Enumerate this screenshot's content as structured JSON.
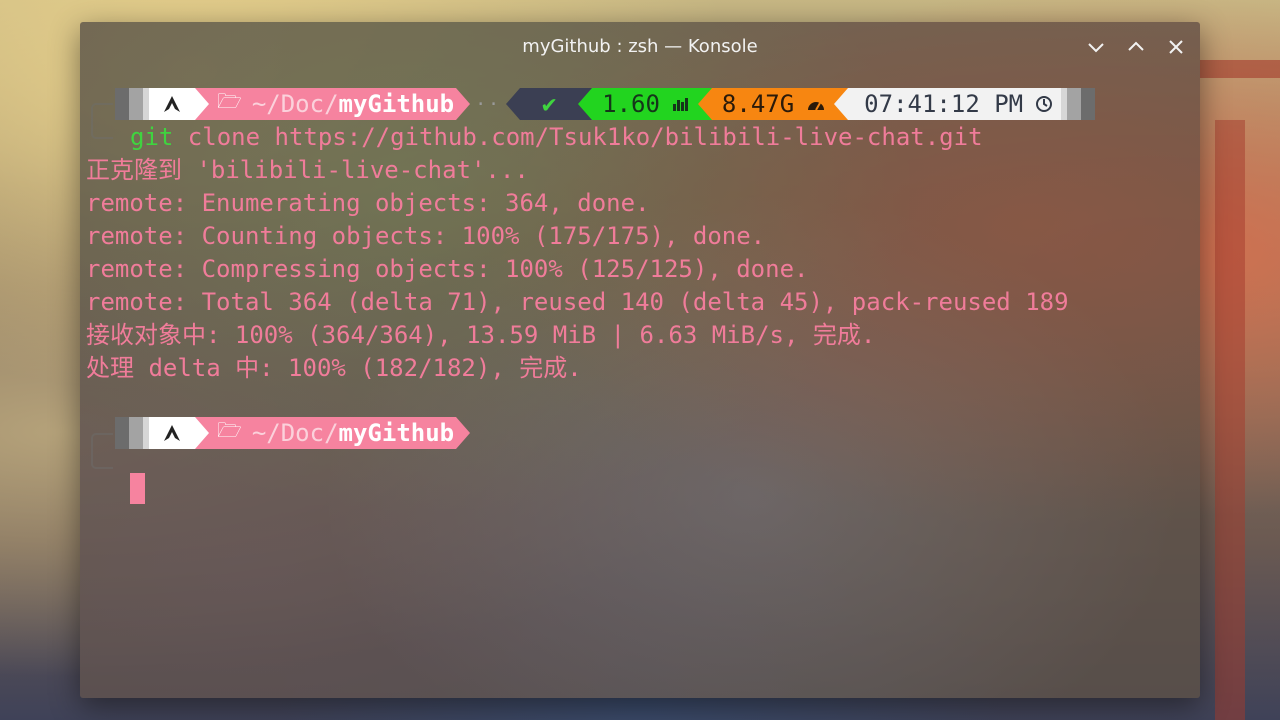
{
  "window": {
    "title": "myGithub : zsh — Konsole"
  },
  "titlebar_buttons": {
    "minimize_icon": "chevron-down-icon",
    "maximize_icon": "chevron-up-icon",
    "close_icon": "close-icon"
  },
  "prompt1": {
    "os_icon": "arch-linux-icon",
    "folder_icon": "folder-icon",
    "path_prefix": "~/",
    "path_middle": "Doc",
    "path_sep": "/",
    "path_current": "myGithub",
    "filler": "··",
    "status": "✔",
    "load": "1.60",
    "load_icon": "bar-chart-icon",
    "memory": "8.47G",
    "memory_icon": "gauge-icon",
    "time": "07:41:12 PM",
    "time_icon": "clock-icon"
  },
  "command": {
    "name": "git",
    "args": " clone https://github.com/Tsuk1ko/bilibili-live-chat.git"
  },
  "output": [
    "正克隆到 'bilibili-live-chat'...",
    "remote: Enumerating objects: 364, done.",
    "remote: Counting objects: 100% (175/175), done.",
    "remote: Compressing objects: 100% (125/125), done.",
    "remote: Total 364 (delta 71), reused 140 (delta 45), pack-reused 189",
    "接收对象中: 100% (364/364), 13.59 MiB | 6.63 MiB/s, 完成.",
    "处理 delta 中: 100% (182/182), 完成."
  ],
  "prompt2": {
    "os_icon": "arch-linux-icon",
    "folder_icon": "folder-icon",
    "path_prefix": "~/",
    "path_middle": "Doc",
    "path_sep": "/",
    "path_current": "myGithub"
  },
  "colors": {
    "prompt_pink": "#f6839f",
    "output_text": "#f07c9a",
    "command_green": "#3fd43f",
    "load_bg": "#22d41f",
    "memory_bg": "#f78611",
    "time_bg": "#f2f2f2",
    "status_bg": "#3b3f53"
  }
}
